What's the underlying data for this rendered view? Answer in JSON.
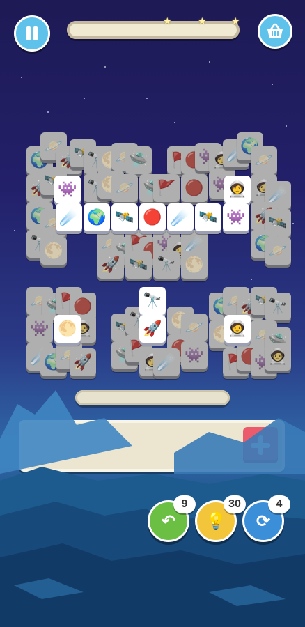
{
  "hud": {
    "pause_icon": "pause-icon",
    "shop_icon": "basket-icon",
    "progress": {
      "fraction": 0.0,
      "stars": 3
    }
  },
  "board": {
    "tile_icons": [
      "alien-monster",
      "astronaut-helmet",
      "comet",
      "planet-earth",
      "planet-ringed",
      "rocket",
      "satellite",
      "telescope",
      "moon",
      "saturn",
      "ufo",
      "flag",
      "mars"
    ]
  },
  "powerups": {
    "undo": {
      "count": "9",
      "color": "#6bbf43",
      "icon": "undo-arrow-icon"
    },
    "hint": {
      "count": "30",
      "color": "#f2c53a",
      "icon": "lightbulb-icon"
    },
    "shuffle": {
      "count": "4",
      "color": "#3b8fd9",
      "icon": "shuffle-icon"
    }
  },
  "tray": {
    "add_icon": "plus-icon"
  }
}
